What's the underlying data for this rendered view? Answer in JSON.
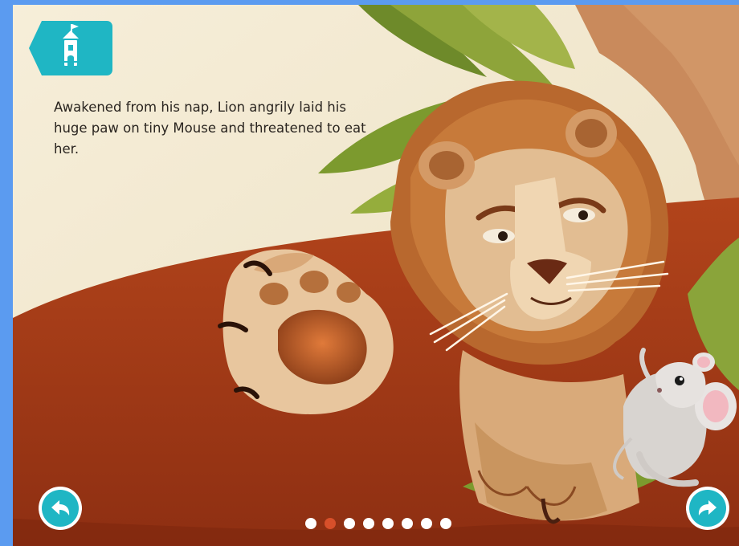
{
  "story": {
    "text": "Awakened from his nap, Lion angrily laid his huge paw on tiny Mouse and threatened to eat her."
  },
  "navigation": {
    "home_icon": "castle-tower-icon",
    "back_icon": "back-arrow-icon",
    "next_icon": "forward-arrow-icon",
    "page_count": 8,
    "current_page": 2
  },
  "colors": {
    "accent": "#1fb6c4",
    "active_dot": "#d8502a",
    "frame": "#5b9bf0"
  }
}
